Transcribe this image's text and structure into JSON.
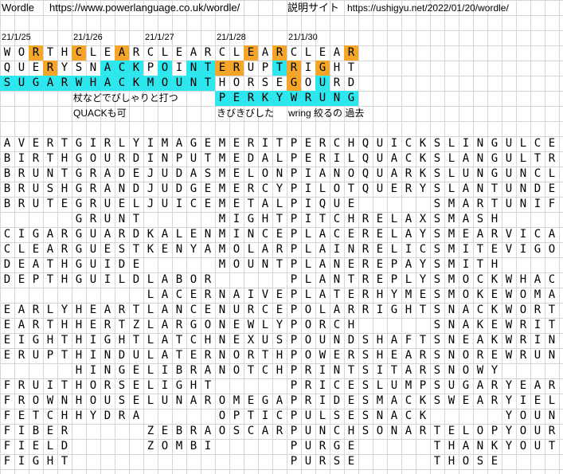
{
  "header": {
    "title": "Wordle",
    "url": "https://www.powerlanguage.co.uk/wordle/",
    "label": "説明サイト",
    "ref_url": "https://ushigyu.net/2022/01/20/wordle/"
  },
  "colors": {
    "orange": "#f4a52a",
    "cyan": "#2ee6ee",
    "grid": "#d6d6d6"
  },
  "games": [
    {
      "date": "21/1/25",
      "rows": [
        {
          "letters": "WORTH",
          "marks": "__O__"
        },
        {
          "letters": "QUERY",
          "marks": "___O_"
        },
        {
          "letters": "SUGAR",
          "marks": "CCCCC"
        }
      ]
    },
    {
      "date": "21/1/26",
      "rows": [
        {
          "letters": "CLEAR",
          "marks": "O__O_"
        },
        {
          "letters": "SNACK",
          "marks": "__CCC"
        },
        {
          "letters": "WHACK",
          "marks": "CCCCC"
        }
      ],
      "notes": [
        "杖などでぴしゃりと打つ",
        "QUACKも可"
      ]
    },
    {
      "date": "21/1/27",
      "rows": [
        {
          "letters": "CLEAR",
          "marks": "_____"
        },
        {
          "letters": "POINT",
          "marks": "_C_CC"
        },
        {
          "letters": "MOUNT",
          "marks": "CCCCC"
        }
      ]
    },
    {
      "date": "21/1/28",
      "rows": [
        {
          "letters": "CLEAR",
          "marks": "__O_O"
        },
        {
          "letters": "ERUPT",
          "marks": "OO__C"
        },
        {
          "letters": "HORSE",
          "marks": "_____"
        },
        {
          "letters": "PERKY",
          "marks": "CCCCC"
        }
      ],
      "notes": [
        "きびきびした"
      ]
    },
    {
      "date": "21/1/30",
      "rows": [
        {
          "letters": "CLEAR",
          "marks": "____O"
        },
        {
          "letters": "RIGHT",
          "marks": "O_O__"
        },
        {
          "letters": "GOURD",
          "marks": "O_C__"
        },
        {
          "letters": "WRUNG",
          "marks": "CCCCC"
        }
      ],
      "notes": [
        "wring 絞るの 過去"
      ]
    }
  ],
  "word_columns": [
    [
      "AVERT",
      "BIRTH",
      "BRUNT",
      "BRUSH",
      "BRUTE",
      "",
      "CIGAR",
      "CLEAR",
      "DEATH",
      "DEPTH",
      "",
      "EARLY",
      "EARTH",
      "EIGHT",
      "ERUPT",
      "",
      "FRUIT",
      "FROWN",
      "FETCH",
      "FIBER",
      "FIELD",
      "FIGHT"
    ],
    [
      "GIRLY",
      "GOURD",
      "GRADE",
      "GRAND",
      "GRUEL",
      "GRUNT",
      "GUARD",
      "GUEST",
      "GUIDE",
      "GUILD",
      "",
      "HEART",
      "HERTZ",
      "HIGHT",
      "HINDU",
      "HINGE",
      "HORSE",
      "HOUSE",
      "HYDRA",
      "",
      "",
      ""
    ],
    [
      "IMAGE",
      "INPUT",
      "JUDAS",
      "JUDGE",
      "JUICE",
      "",
      "KALEN",
      "KENYA",
      "",
      "LABOR",
      "LACER",
      "LANCE",
      "LARGO",
      "LATCH",
      "LATER",
      "LIBRA",
      "LIGHT",
      "LUNAR",
      "",
      "ZEBRA",
      "ZOMBI",
      ""
    ],
    [
      "MERIT",
      "MEDAL",
      "MELON",
      "MERCY",
      "METAL",
      "MIGHT",
      "MINCE",
      "MOLAR",
      "MOUNT",
      "",
      "NAIVE",
      "NURCE",
      "NEWLY",
      "NEXUS",
      "NORTH",
      "NOTCH",
      "",
      "OMEGA",
      "OPTIC",
      "OSCAR",
      "",
      ""
    ],
    [
      "PERCH",
      "PERIL",
      "PIANO",
      "PILOT",
      "PIQUE",
      "PITCH",
      "PLACE",
      "PLAIN",
      "PLANE",
      "PLANT",
      "PLATE",
      "POLAR",
      "PORCH",
      "POUND",
      "POWER",
      "PRINT",
      "PRICE",
      "PRIDE",
      "PULSE",
      "PUNCH",
      "PURGE",
      "PURSE"
    ],
    [
      "QUICK",
      "QUACK",
      "QUARK",
      "QUERY",
      "",
      "RELAX",
      "RELAY",
      "RELIC",
      "REPAY",
      "REPLY",
      "RHYME",
      "RIGHT",
      "",
      "SHAFT",
      "SHEAR",
      "SITAR",
      "SLUMP",
      "SMACK",
      "SNACK",
      "SONAR",
      "",
      ""
    ],
    [
      "SLING",
      "SLANG",
      "SLUNG",
      "SLANT",
      "SMART",
      "SMASH",
      "SMEAR",
      "SMITE",
      "SMITH",
      "SMOCK",
      "SMOKE",
      "SNACK",
      "SNAKE",
      "SNEAK",
      "SNORE",
      "SNOWY",
      "SUGAR",
      "SWEAR",
      "",
      "TELOP",
      "THANK",
      "THOSE"
    ],
    [
      "ULCER",
      "ULTRA",
      "UNCLE",
      "UNDER",
      "UNIFY",
      "",
      "VICAR",
      "VIGOR",
      "",
      "WHACK",
      "WOMAN",
      "WORTH",
      "WRITE",
      "WRING",
      "WRUNG",
      "",
      "YEARN",
      "YIELD",
      "YOUNG",
      "YOURS",
      "YOUTH",
      ""
    ]
  ]
}
